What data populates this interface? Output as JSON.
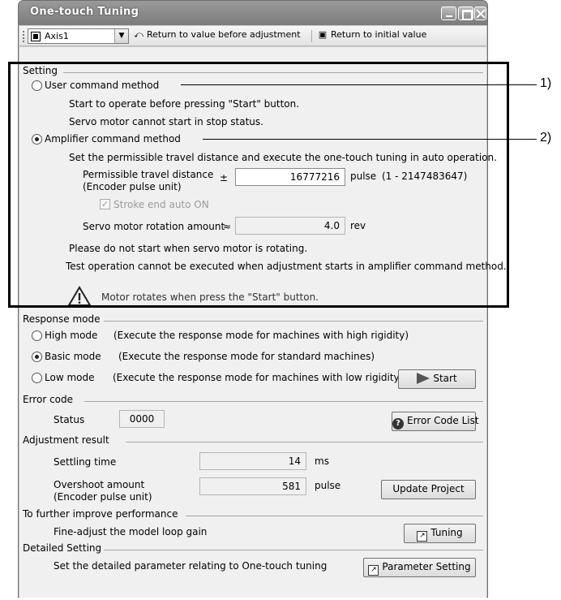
{
  "window": {
    "title": "One-touch Tuning"
  },
  "toolbar": {
    "axis_value": "Axis1",
    "return_before_label": "Return to value before adjustment",
    "return_initial_label": "Return to initial value"
  },
  "setting": {
    "section": "Setting",
    "user_method": {
      "label": "User command method",
      "note1": "Start to operate before pressing \"Start\" button.",
      "note2": "Servo motor cannot start in stop status.",
      "selected": false
    },
    "amp_method": {
      "label": "Amplifier command method",
      "selected": true,
      "desc": "Set the permissible travel distance and execute the one-touch tuning in auto operation.",
      "travel_label1": "Permissible travel distance",
      "travel_label2": "(Encoder pulse unit)",
      "plusminus": "±",
      "travel_value": "16777216",
      "travel_unit": "pulse",
      "travel_range": "(1 - 2147483647)",
      "stroke_label": "Stroke end auto ON",
      "rotation_label": "Servo motor rotation amount",
      "approx": "≈",
      "rotation_value": "4.0",
      "rotation_unit": "rev",
      "warn1": "Please do not start when servo motor is rotating.",
      "warn2": "Test operation cannot be executed when adjustment starts in amplifier command method.",
      "caution": "Motor rotates when press the \"Start\" button."
    }
  },
  "response_mode": {
    "section": "Response mode",
    "options": [
      {
        "label": "High mode",
        "desc": "(Execute the response mode for machines with high rigidity)",
        "selected": false
      },
      {
        "label": "Basic mode",
        "desc": "(Execute the response mode for standard machines)",
        "selected": true
      },
      {
        "label": "Low mode",
        "desc": "(Execute the response mode for machines with low rigidity)",
        "selected": false
      }
    ],
    "start_label": "Start"
  },
  "error_code": {
    "section": "Error code",
    "status_label": "Status",
    "status_value": "0000",
    "list_button": "Error Code List"
  },
  "adjustment": {
    "section": "Adjustment result",
    "settling_label": "Settling time",
    "settling_value": "14",
    "settling_unit": "ms",
    "overshoot_label1": "Overshoot amount",
    "overshoot_label2": "(Encoder pulse unit)",
    "overshoot_value": "581",
    "overshoot_unit": "pulse",
    "update_button": "Update Project"
  },
  "improve": {
    "section": "To further improve performance",
    "text": "Fine-adjust the model loop gain",
    "button": "Tuning"
  },
  "detailed": {
    "section": "Detailed Setting",
    "text": "Set the detailed parameter relating to One-touch tuning",
    "button": "Parameter Setting"
  },
  "callouts": {
    "label1": "1)",
    "label2": "2)"
  }
}
